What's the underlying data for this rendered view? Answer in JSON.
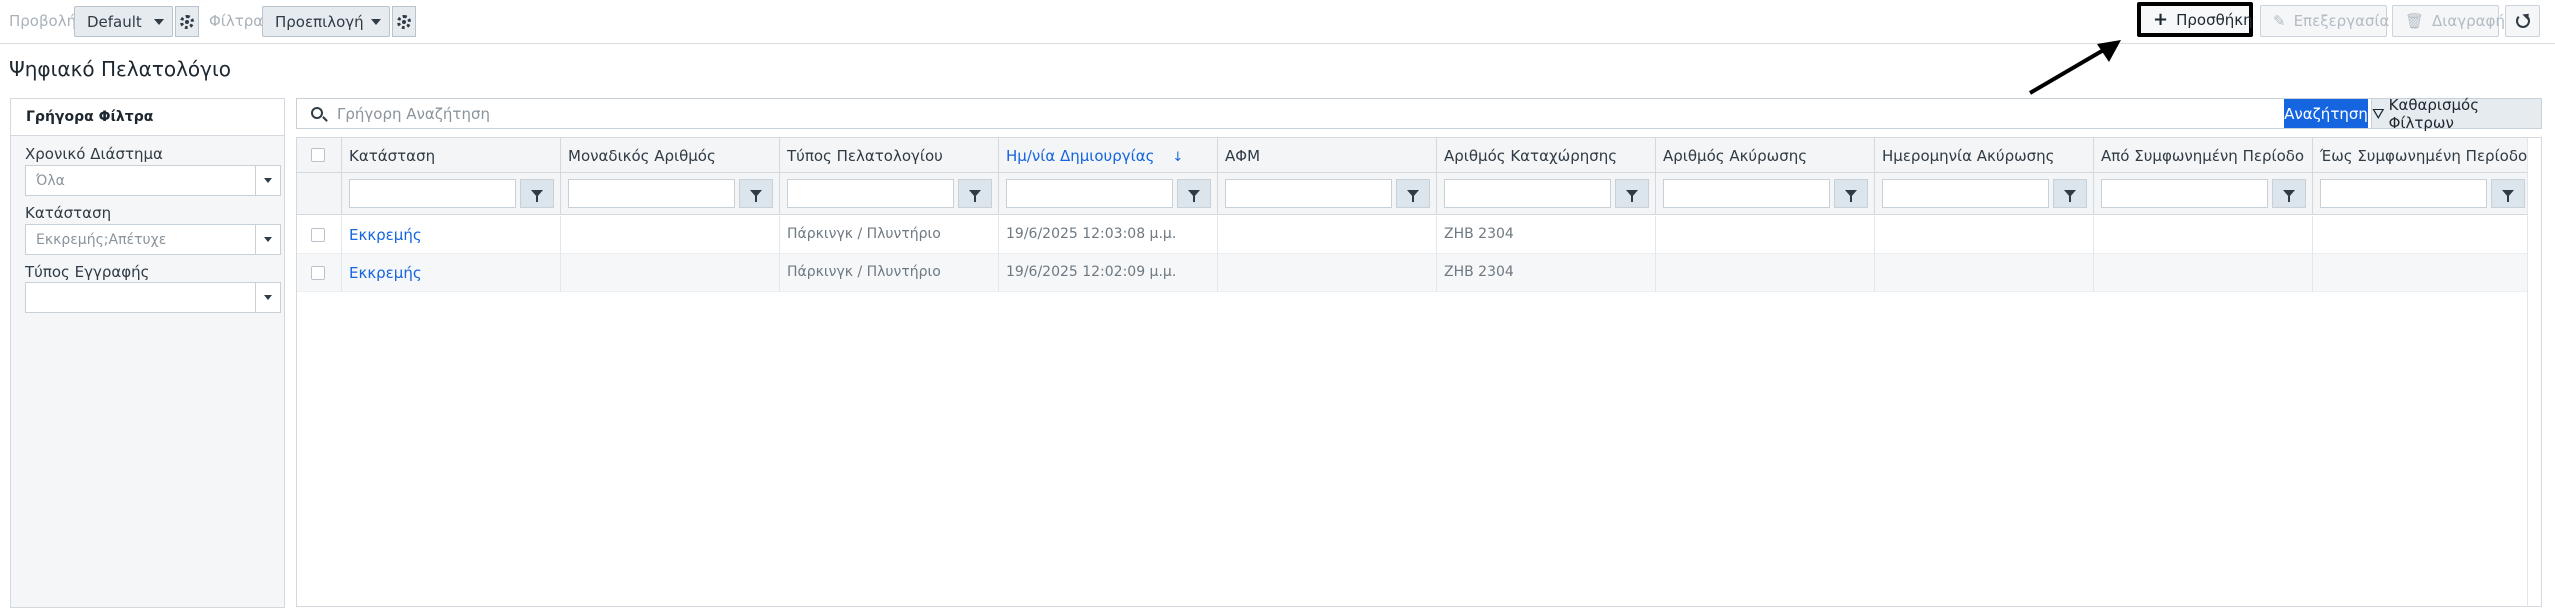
{
  "toolbar": {
    "view_label": "Προβολή",
    "view_value": "Default",
    "filters_label": "Φίλτρα",
    "filters_value": "Προεπιλογή",
    "add_label": "Προσθήκη",
    "edit_label": "Επεξεργασία",
    "delete_label": "Διαγραφή"
  },
  "page": {
    "title": "Ψηφιακό Πελατολόγιο"
  },
  "quick_filters": {
    "title": "Γρήγορα Φίλτρα",
    "fields": [
      {
        "label": "Χρονικό Διάστημα",
        "value": "Όλα"
      },
      {
        "label": "Κατάσταση",
        "value": "Εκκρεμής;Απέτυχε"
      },
      {
        "label": "Τύπος Εγγραφής",
        "value": ""
      }
    ]
  },
  "search": {
    "placeholder": "Γρήγορη Αναζήτηση",
    "search_label": "Αναζήτηση",
    "clear_label": "Καθαρισμός Φίλτρων"
  },
  "grid": {
    "columns": [
      "Κατάσταση",
      "Μοναδικός Αριθμός",
      "Τύπος Πελατολογίου",
      "Ημ/νία Δημιουργίας",
      "ΑΦΜ",
      "Αριθμός Καταχώρησης",
      "Αριθμός Ακύρωσης",
      "Ημερομηνία Ακύρωσης",
      "Από Συμφωνημένη Περίοδο",
      "Έως Συμφωνημένη Περίοδο"
    ],
    "sorted_column": "Ημ/νία Δημιουργίας",
    "rows": [
      [
        "Εκκρεμής",
        "",
        "Πάρκινγκ / Πλυντήριο",
        "19/6/2025 12:03:08 μ.μ.",
        "",
        "ZHB 2304",
        "",
        "",
        "",
        ""
      ],
      [
        "Εκκρεμής",
        "",
        "Πάρκινγκ / Πλυντήριο",
        "19/6/2025 12:02:09 μ.μ.",
        "",
        "ZHB 2304",
        "",
        "",
        "",
        ""
      ]
    ]
  },
  "colors": {
    "accent": "#1565e0",
    "border": "#d3d9df"
  }
}
